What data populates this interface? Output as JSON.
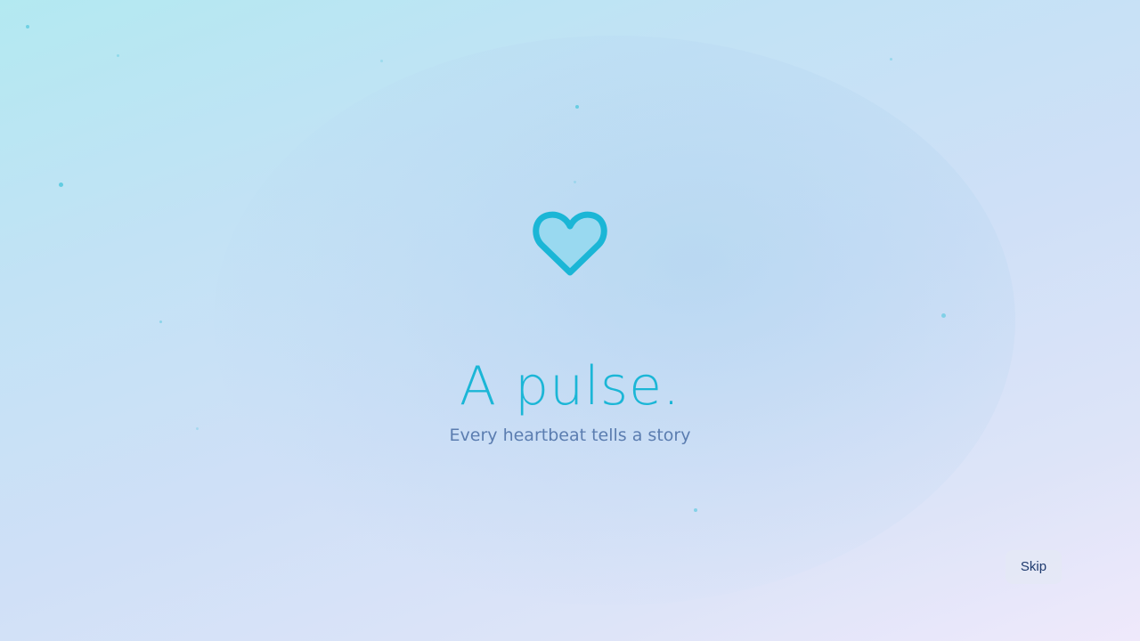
{
  "splash": {
    "title": "A pulse.",
    "subtitle": "Every heartbeat tells a story",
    "icon": "heart-icon"
  },
  "controls": {
    "skip_label": "Skip"
  },
  "colors": {
    "accent": "#1bb6d6",
    "heart_fill": "#93d8ee",
    "subtitle": "#5b7db0",
    "button_text": "#1e3a6e",
    "button_bg": "#e4e8f6",
    "particle": "#52c8dd"
  }
}
